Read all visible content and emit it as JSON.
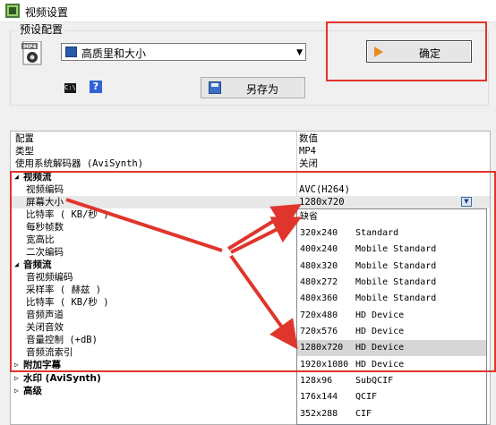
{
  "window": {
    "title": "视频设置"
  },
  "preset": {
    "group_label": "预设配置",
    "file_icon_label": "MP4",
    "selected": "高质里和大小",
    "cmd_icon_text": "C:\\",
    "help_icon_text": "?",
    "save_as_label": "另存为",
    "ok_label": "确定"
  },
  "grid": {
    "header": {
      "name": "配置",
      "value": "数值"
    },
    "rows": [
      {
        "name": "类型",
        "value": "MP4"
      },
      {
        "name": "使用系统解码器 (AviSynth)",
        "value": "关闭"
      },
      {
        "name": "视频流",
        "value": ""
      },
      {
        "name": "视频编码",
        "value": "AVC(H264)"
      },
      {
        "name": "屏幕大小",
        "value": "1280x720"
      },
      {
        "name": "比特率 ( KB/秒 )",
        "value": ""
      },
      {
        "name": "每秒帧数",
        "value": ""
      },
      {
        "name": "宽高比",
        "value": ""
      },
      {
        "name": "二次编码",
        "value": ""
      },
      {
        "name": "音频流",
        "value": ""
      },
      {
        "name": "音视频编码",
        "value": ""
      },
      {
        "name": "采样率 ( 赫兹 )",
        "value": ""
      },
      {
        "name": "比特率 ( KB/秒 )",
        "value": ""
      },
      {
        "name": "音频声道",
        "value": ""
      },
      {
        "name": "关闭音效",
        "value": ""
      },
      {
        "name": "音量控制 (+dB)",
        "value": ""
      },
      {
        "name": "音频流索引",
        "value": ""
      },
      {
        "name": "附加字幕",
        "value": ""
      },
      {
        "name": "水印 (AviSynth)",
        "value": ""
      },
      {
        "name": "高级",
        "value": ""
      }
    ]
  },
  "dropdown": {
    "options": [
      {
        "res": "缺省",
        "desc": ""
      },
      {
        "res": "320x240",
        "desc": "Standard"
      },
      {
        "res": "400x240",
        "desc": "Mobile Standard"
      },
      {
        "res": "480x320",
        "desc": "Mobile Standard"
      },
      {
        "res": "480x272",
        "desc": "Mobile Standard"
      },
      {
        "res": "480x360",
        "desc": "Mobile Standard"
      },
      {
        "res": "720x480",
        "desc": "HD Device"
      },
      {
        "res": "720x576",
        "desc": "HD Device"
      },
      {
        "res": "1280x720",
        "desc": "HD Device"
      },
      {
        "res": "1920x1080",
        "desc": "HD Device"
      },
      {
        "res": "128x96",
        "desc": "SubQCIF"
      },
      {
        "res": "176x144",
        "desc": "QCIF"
      },
      {
        "res": "352x288",
        "desc": "CIF"
      }
    ],
    "highlighted": "1280x720 HD Device"
  },
  "colors": {
    "annotation_red": "#e0352c",
    "highlight": "#d6d6d6"
  }
}
